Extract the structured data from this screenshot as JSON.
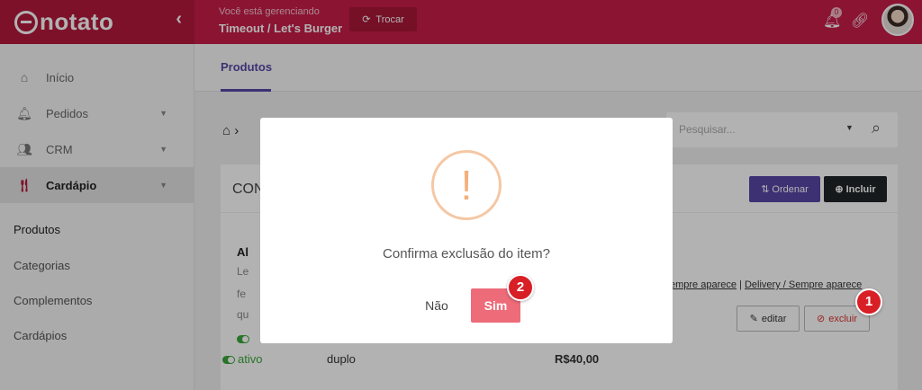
{
  "brand": {
    "logo_text": "notato"
  },
  "topbar": {
    "managing_label": "Você está gerenciando",
    "store_name": "Timeout / Let's Burger",
    "switch_label": "Trocar",
    "notification_count": "0"
  },
  "sidebar": {
    "items": [
      {
        "label": "Início",
        "icon": "home-icon"
      },
      {
        "label": "Pedidos",
        "icon": "bell-icon"
      },
      {
        "label": "CRM",
        "icon": "users-icon"
      },
      {
        "label": "Cardápio",
        "icon": "utensils-icon"
      }
    ],
    "sub_items": [
      "Produtos",
      "Categorias",
      "Complementos",
      "Cardápios"
    ]
  },
  "main": {
    "tab": "Produtos",
    "search_placeholder": "Pesquisar...",
    "card_title": "CON",
    "order_label": "Ordenar",
    "include_label": "Incluir",
    "item_name": "Al",
    "desc_lines": [
      "Le",
      "fe",
      "qu"
    ],
    "tags_part1": "empre aparece",
    "tags_sep": " | ",
    "tags_part2": "Delivery / Sempre aparece",
    "edit_label": "editar",
    "delete_label": "excluir",
    "status": "ativo",
    "variant": "duplo",
    "price": "R$40,00"
  },
  "modal": {
    "icon": "!",
    "message": "Confirma exclusão do item?",
    "no_label": "Não",
    "yes_label": "Sim"
  },
  "steps": {
    "first": "1",
    "second": "2"
  },
  "colors": {
    "brand": "#c81e4a",
    "accent": "#5847a6",
    "confirm": "#ee6b79",
    "step": "#d91f26"
  }
}
